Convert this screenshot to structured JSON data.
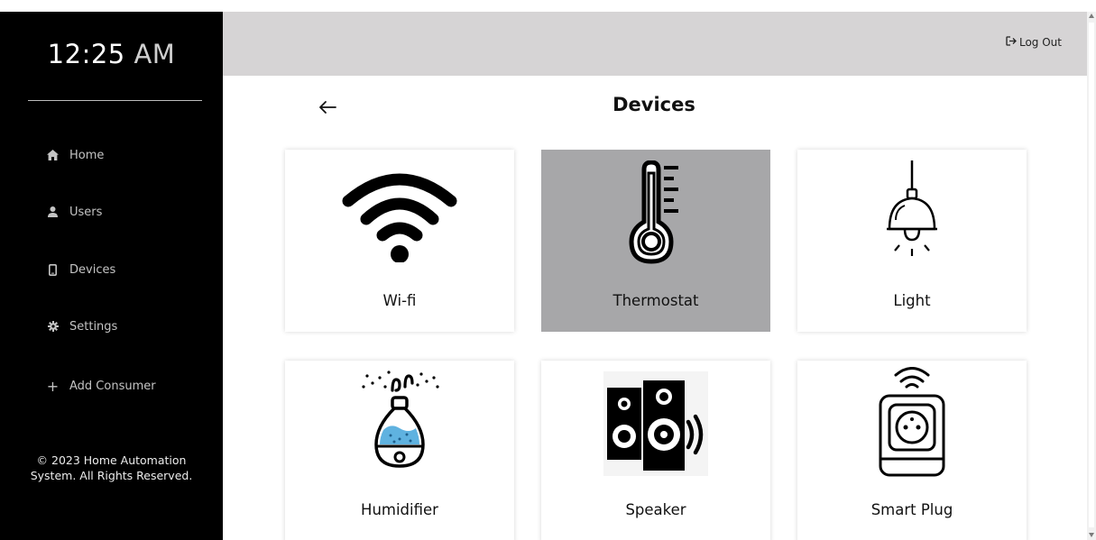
{
  "sidebar": {
    "clock_time": "12:25",
    "clock_ampm": "AM",
    "items": [
      {
        "label": "Home",
        "icon": "home-icon"
      },
      {
        "label": "Users",
        "icon": "user-icon"
      },
      {
        "label": "Devices",
        "icon": "device-icon"
      },
      {
        "label": "Settings",
        "icon": "gear-icon"
      },
      {
        "label": "Add Consumer",
        "icon": "plus-icon"
      }
    ],
    "copyright_line1": "© 2023 Home Automation",
    "copyright_line2": "System. All Rights Reserved."
  },
  "header": {
    "logout_label": "Log Out",
    "logout_icon": "logout-icon"
  },
  "main": {
    "title": "Devices",
    "back_icon": "arrow-left-icon",
    "selected_device": "Thermostat",
    "devices": [
      {
        "label": "Wi-fi",
        "icon": "wifi-icon"
      },
      {
        "label": "Thermostat",
        "icon": "thermometer-icon"
      },
      {
        "label": "Light",
        "icon": "lamp-icon"
      },
      {
        "label": "Humidifier",
        "icon": "humidifier-icon"
      },
      {
        "label": "Speaker",
        "icon": "speaker-icon"
      },
      {
        "label": "Smart Plug",
        "icon": "smart-plug-icon"
      }
    ]
  },
  "colors": {
    "sidebar_bg": "#000000",
    "topbar_bg": "#d6d4d5",
    "selected_card_bg": "#a7a7a9",
    "humidifier_water": "#5fb2e0"
  }
}
